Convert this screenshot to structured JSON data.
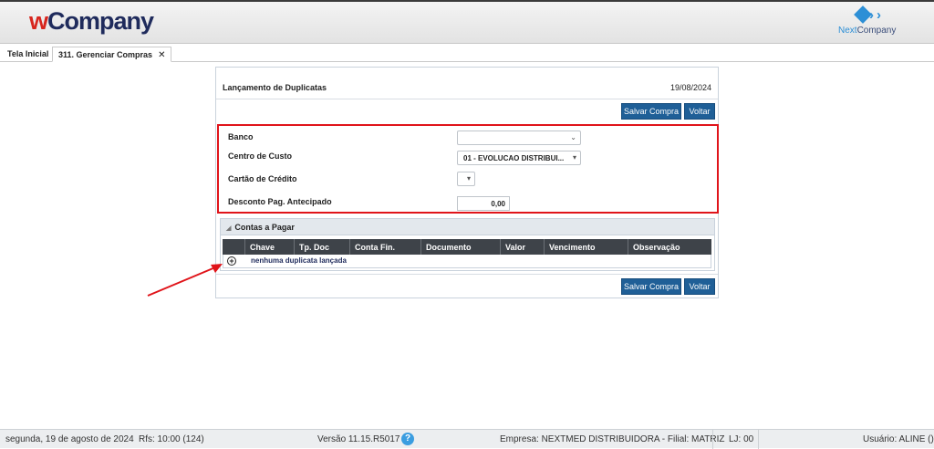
{
  "header": {
    "logo_w": "w",
    "logo_rest": "Company",
    "next_logo_a": "Next",
    "next_logo_b": "Company"
  },
  "tabs": [
    {
      "label": "Tela Inicial"
    },
    {
      "label": "311. Gerenciar Compras",
      "close": "✕"
    }
  ],
  "panel": {
    "title": "Lançamento de Duplicatas",
    "date": "19/08/2024",
    "save_label": "Salvar Compra",
    "back_label": "Voltar"
  },
  "form": {
    "banco_label": "Banco",
    "banco_value": "",
    "centro_label": "Centro de Custo",
    "centro_value": "01 - EVOLUCAO DISTRIBUI...",
    "cartao_label": "Cartão de Crédito",
    "cartao_value": "",
    "desconto_label": "Desconto Pag. Antecipado",
    "desconto_value": "0,00"
  },
  "contas": {
    "title": "Contas a Pagar",
    "columns": [
      "Chave",
      "Tp. Doc",
      "Conta Fin.",
      "Documento",
      "Valor",
      "Vencimento",
      "Observação"
    ],
    "empty_text": "nenhuma duplicata lançada"
  },
  "status": {
    "date_text": "segunda, 19 de agosto de 2024",
    "rfs_text": "Rfs: 10:00 (124)",
    "version_text": "Versão 11.15.R5017",
    "help_glyph": "?",
    "empresa_text": "Empresa: NEXTMED DISTRIBUIDORA - Filial: MATRIZ",
    "lj_text": "LJ: 00",
    "usuario_text": "Usuário: ALINE ()"
  },
  "colors": {
    "accent_button": "#1f5f97",
    "highlight_border": "#e0141a",
    "table_header": "#3e4349"
  }
}
